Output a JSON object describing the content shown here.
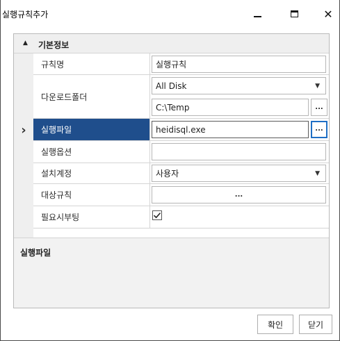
{
  "window": {
    "title": "실행규칙추가",
    "minimize_icon": "minimize-icon",
    "maximize_icon": "maximize-icon",
    "close_glyph": "✕"
  },
  "group": {
    "arrow": "▲",
    "title": "기본정보"
  },
  "row_pointer": "›",
  "properties": {
    "rule_name": {
      "label": "규칙명",
      "value": "실행규칙"
    },
    "download_folder": {
      "label": "다운로드폴더",
      "drive": "All Disk",
      "path": "C:\\Temp"
    },
    "exec_file": {
      "label": "실행파일",
      "value": "heidisql.exe"
    },
    "exec_options": {
      "label": "실행옵션",
      "value": ""
    },
    "install_account": {
      "label": "설치계정",
      "value": "사용자"
    },
    "target_rule": {
      "label": "대상규칙",
      "value": "..."
    },
    "reboot_required": {
      "label": "필요시부팅",
      "checked": true
    }
  },
  "ellipsis": "...",
  "combo_arrow": "▼",
  "description": {
    "title": "실행파일"
  },
  "buttons": {
    "ok": "확인",
    "cancel": "닫기"
  },
  "colors": {
    "selection": "#1f4e8c",
    "focus_border": "#1f6fc5"
  }
}
